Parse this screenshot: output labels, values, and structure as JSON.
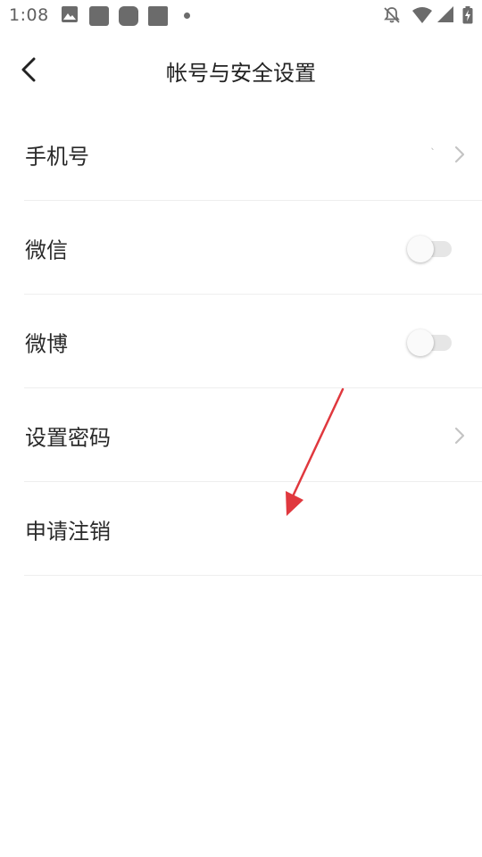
{
  "status_bar": {
    "time": "1:08",
    "icons": [
      "photo-icon",
      "notification-square-icon",
      "notification-square-icon",
      "notification-square-icon",
      "more-dot-icon",
      "bell-off-icon",
      "wifi-icon",
      "signal-icon",
      "battery-charging-icon"
    ]
  },
  "header": {
    "title": "帐号与安全设置",
    "back_icon": "chevron-left-icon"
  },
  "settings": {
    "items": [
      {
        "label": "手机号",
        "value": "`",
        "control": "chevron"
      },
      {
        "label": "微信",
        "control": "toggle",
        "enabled": false
      },
      {
        "label": "微博",
        "control": "toggle",
        "enabled": false
      },
      {
        "label": "设置密码",
        "control": "chevron"
      },
      {
        "label": "申请注销",
        "control": "none"
      }
    ]
  },
  "colors": {
    "annotation_arrow": "#e0383e",
    "divider": "#eeeeee",
    "toggle_track": "#e6e6e6",
    "chevron": "#c4c4c4"
  }
}
